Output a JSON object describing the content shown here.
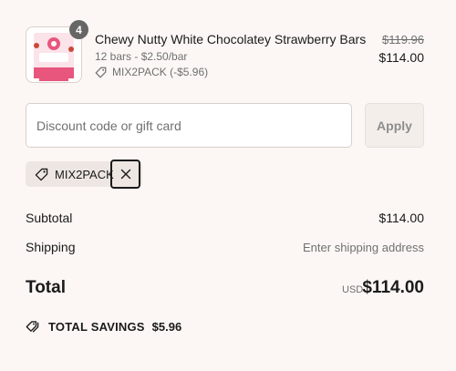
{
  "product": {
    "quantity": "4",
    "title": "Chewy Nutty White Chocolatey Strawberry Bars",
    "variant": "12 bars - $2.50/bar",
    "discount_line": "MIX2PACK (-$5.96)",
    "original_price": "$119.96",
    "price": "$114.00",
    "thumbnail_icon": "product-package-image"
  },
  "discount": {
    "placeholder": "Discount code or gift card",
    "value": "",
    "apply_label": "Apply",
    "applied_code": "MIX2PACK",
    "tag_icon": "tag-icon",
    "remove_icon": "close-icon"
  },
  "summary": {
    "subtotal_label": "Subtotal",
    "subtotal_value": "$114.00",
    "shipping_label": "Shipping",
    "shipping_value": "Enter shipping address",
    "total_label": "Total",
    "total_currency": "USD",
    "total_value": "$114.00",
    "savings_label": "TOTAL SAVINGS",
    "savings_value": "$5.96",
    "savings_icon": "discount-tags-icon"
  },
  "colors": {
    "background": "#fcf7f4",
    "chip_background": "#ede6e2",
    "muted_text": "#707070",
    "badge": "#666666"
  }
}
